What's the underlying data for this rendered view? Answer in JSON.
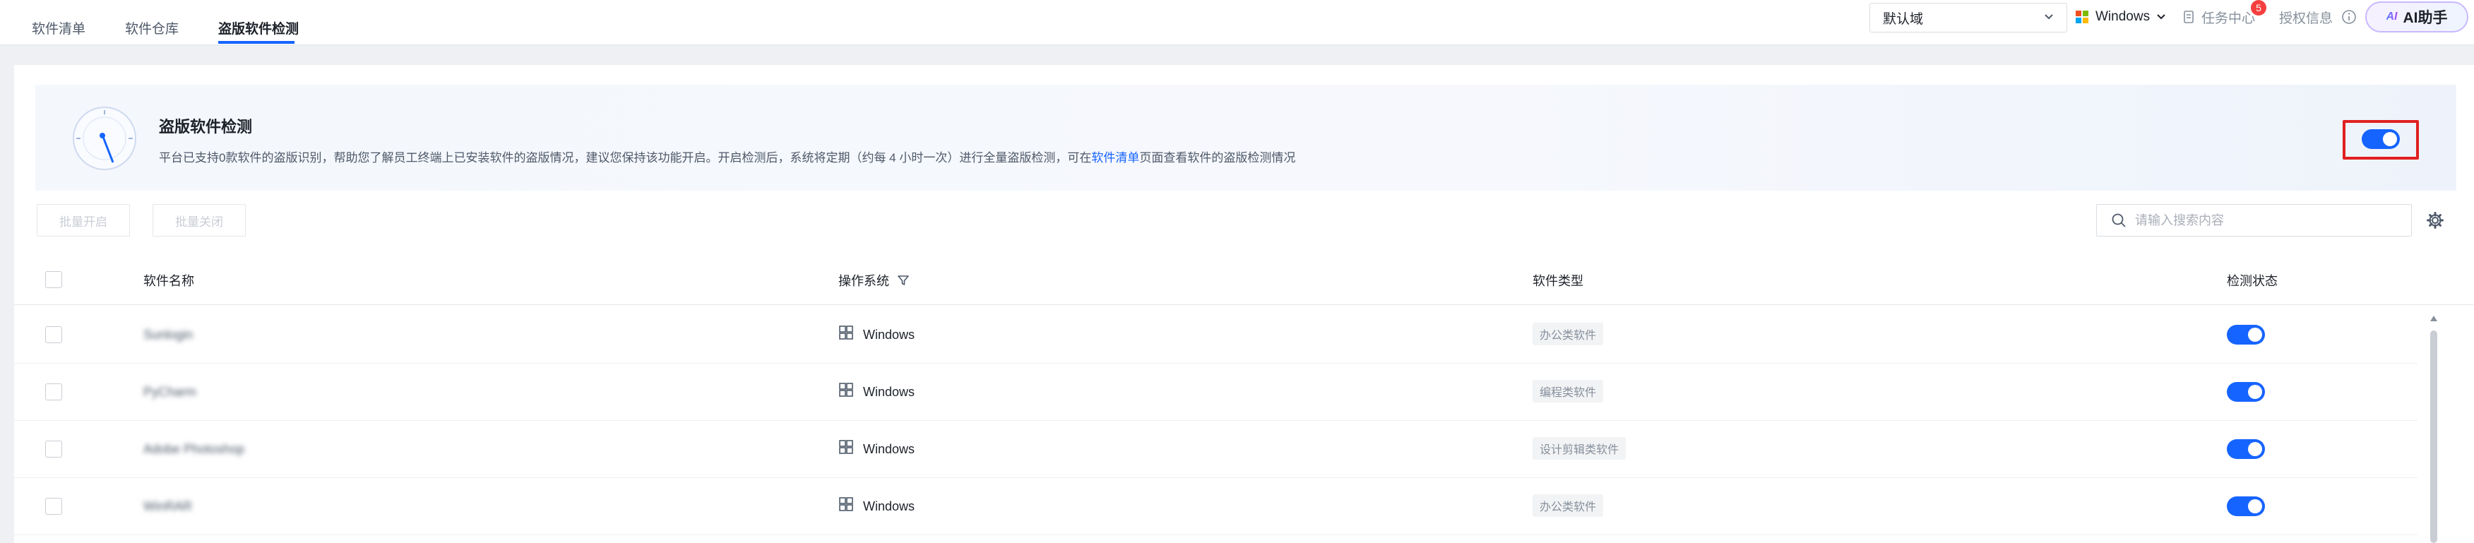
{
  "tabs": [
    {
      "label": "软件清单"
    },
    {
      "label": "软件仓库"
    },
    {
      "label": "盗版软件检测"
    }
  ],
  "topbar": {
    "domain_select": "默认域",
    "os_select": "Windows",
    "task_center": "任务中心",
    "task_badge": "5",
    "license": "授权信息",
    "ai_button": "AI助手",
    "ai_logo": "AI"
  },
  "banner": {
    "title": "盗版软件检测",
    "desc_before": "平台已支持0款软件的盗版识别，帮助您了解员工终端上已安装软件的盗版情况，建议您保持该功能开启。开启检测后，系统将定期（约每 4 小时一次）进行全量盗版检测，可在",
    "desc_link": "软件清单",
    "desc_after": "页面查看软件的盗版检测情况",
    "toggle_on": true
  },
  "toolbar": {
    "batch_enable": "批量开启",
    "batch_disable": "批量关闭",
    "search_placeholder": "请输入搜索内容"
  },
  "table": {
    "columns": [
      "软件名称",
      "操作系统",
      "软件类型",
      "检测状态"
    ],
    "rows": [
      {
        "name": "Sunlogin",
        "os": "Windows",
        "type": "办公类软件",
        "detect": true
      },
      {
        "name": "PyCharm",
        "os": "Windows",
        "type": "编程类软件",
        "detect": true
      },
      {
        "name": "Adobe Photoshop",
        "os": "Windows",
        "type": "设计剪辑类软件",
        "detect": true
      },
      {
        "name": "WinRAR",
        "os": "Windows",
        "type": "办公类软件",
        "detect": true
      }
    ]
  },
  "colors": {
    "accent": "#1664ff",
    "highlight_box": "#e02020",
    "badge": "#f53f3f"
  }
}
